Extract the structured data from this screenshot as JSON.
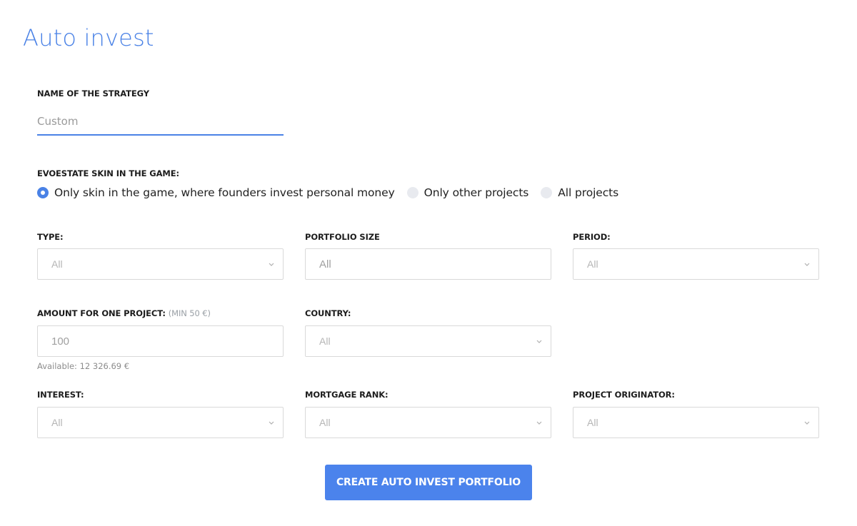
{
  "page": {
    "title": "Auto invest"
  },
  "strategy": {
    "label": "NAME OF THE STRATEGY",
    "value": "Custom"
  },
  "skin_in_game": {
    "label": "EVOESTATE SKIN IN THE GAME:",
    "options": [
      {
        "label": "Only skin in the game, where founders invest personal money",
        "checked": true
      },
      {
        "label": "Only other projects",
        "checked": false
      },
      {
        "label": "All projects",
        "checked": false
      }
    ]
  },
  "filters": {
    "type": {
      "label": "TYPE:",
      "value": "All",
      "icon": "chevron-down-icon"
    },
    "portfolio_size": {
      "label": "PORTFOLIO SIZE",
      "value": "All"
    },
    "period": {
      "label": "PERIOD:",
      "value": "All",
      "icon": "chevron-down-icon"
    },
    "amount": {
      "label": "AMOUNT FOR ONE PROJECT:",
      "hint": "(MIN 50 €)",
      "value": "100",
      "available": "Available: 12 326.69 €"
    },
    "country": {
      "label": "COUNTRY:",
      "value": "All",
      "icon": "chevron-down-icon"
    },
    "interest": {
      "label": "INTEREST:",
      "value": "All",
      "icon": "chevron-down-icon"
    },
    "mortgage_rank": {
      "label": "MORTGAGE RANK:",
      "value": "All",
      "icon": "chevron-down-icon"
    },
    "project_originator": {
      "label": "PROJECT ORIGINATOR:",
      "value": "All",
      "icon": "chevron-down-icon"
    }
  },
  "actions": {
    "create_label": "CREATE AUTO INVEST PORTFOLIO"
  },
  "colors": {
    "accent": "#4a82e6",
    "button": "#4b83ec",
    "radio_unchecked": "#e8eaef",
    "field_border": "#d9d9d9"
  }
}
